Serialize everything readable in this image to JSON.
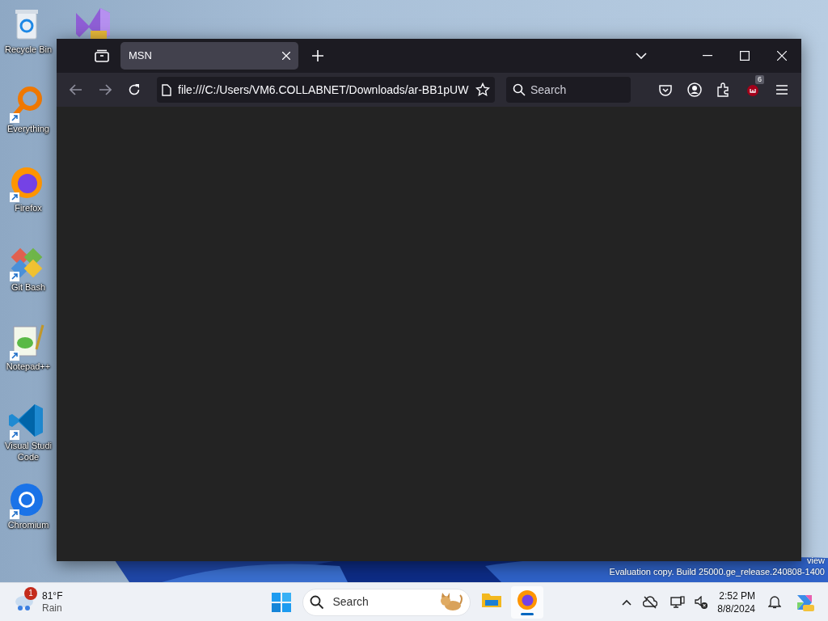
{
  "desktop_icons": [
    {
      "label": "Recycle Bin",
      "kind": "recycle",
      "shortcut": false
    },
    {
      "label": "Everything",
      "kind": "everything",
      "shortcut": true
    },
    {
      "label": "Firefox",
      "kind": "firefox",
      "shortcut": true
    },
    {
      "label": "Git Bash",
      "kind": "gitbash",
      "shortcut": true
    },
    {
      "label": "Notepad++",
      "kind": "notepad",
      "shortcut": true
    },
    {
      "label": "Visual Studi Code",
      "kind": "vscode",
      "shortcut": true
    },
    {
      "label": "Chromium",
      "kind": "chromium",
      "shortcut": true
    }
  ],
  "browser": {
    "tabs": [
      {
        "title": "MSN",
        "selected": true
      }
    ],
    "url": "file:///C:/Users/VM6.COLLABNET/Downloads/ar-BB1pUW",
    "search_placeholder": "Search",
    "extension_badge": "6"
  },
  "build_info": {
    "edition": "view",
    "line": "Evaluation copy. Build 25000.ge_release.240808-1400"
  },
  "taskbar": {
    "weather": {
      "temperature": "81°F",
      "condition": "Rain",
      "badge": "1"
    },
    "search_placeholder": "Search",
    "apps": [
      {
        "kind": "explorer",
        "active": false
      },
      {
        "kind": "firefox",
        "active": true
      }
    ],
    "time": "2:52 PM",
    "date": "8/8/2024"
  }
}
